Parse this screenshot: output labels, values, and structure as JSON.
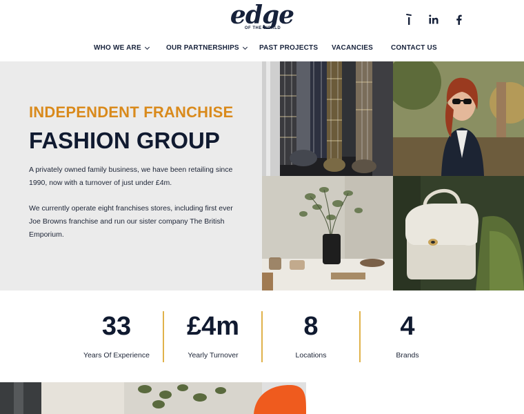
{
  "brand": {
    "logo_script": "edge",
    "logo_sub": "OF THE WORLD"
  },
  "socials": [
    {
      "icon": "i-icon",
      "label": "i"
    },
    {
      "icon": "linkedin-icon",
      "label": "in"
    },
    {
      "icon": "facebook-icon",
      "label": "f"
    }
  ],
  "nav": {
    "items": [
      {
        "label": "WHO WE ARE",
        "has_dropdown": true
      },
      {
        "label": "OUR PARTNERSHIPS",
        "has_dropdown": true
      },
      {
        "label": "PAST PROJECTS",
        "has_dropdown": false
      },
      {
        "label": "VACANCIES",
        "has_dropdown": false
      },
      {
        "label": "CONTACT US",
        "has_dropdown": false
      }
    ]
  },
  "hero": {
    "kicker": "INDEPENDENT FRANCHISE",
    "headline": "FASHION GROUP",
    "para1": "A privately owned family business, we have been retailing since 1990, now with a turnover of just under £4m.",
    "para2": "We currently operate eight franchises stores, including first ever Joe Browns franchise and run our sister company The British Emporium."
  },
  "stats": [
    {
      "value": "33",
      "label": "Years Of Experience"
    },
    {
      "value": "£4m",
      "label": "Yearly Turnover"
    },
    {
      "value": "8",
      "label": "Locations"
    },
    {
      "value": "4",
      "label": "Brands"
    }
  ],
  "colors": {
    "accent": "#d98a1c",
    "navy": "#101a30",
    "divider": "#e0b24a",
    "hero_bg": "#ebebeb"
  }
}
